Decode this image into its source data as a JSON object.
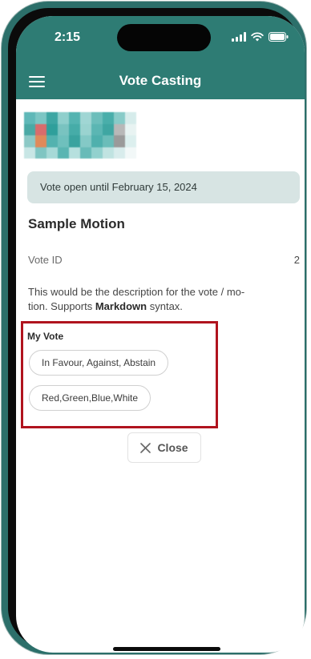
{
  "status_bar": {
    "time": "2:15"
  },
  "app_bar": {
    "title": "Vote Casting"
  },
  "colors": {
    "primary": "#2e7c74",
    "banner": "#d7e4e3",
    "highlight": "#b0131e"
  },
  "logo": {
    "pixels": [
      "#5fb8b8",
      "#7cc6c4",
      "#3da6a3",
      "#8fcfcc",
      "#54b4b1",
      "#a0d6d4",
      "#6cbebb",
      "#49aeaa",
      "#88cbc8",
      "#d6eceb",
      "#4aa9a5",
      "#d96c6c",
      "#2f9f9b",
      "#79c3c0",
      "#46aca8",
      "#9ad3d0",
      "#5bb6b3",
      "#3fa6a2",
      "#b8b8b8",
      "#e8f3f2",
      "#8cc9c6",
      "#e08a5a",
      "#53b2af",
      "#6fc0bd",
      "#3aa39f",
      "#84c9c6",
      "#4fb0ad",
      "#6bbdb9",
      "#9a9a9a",
      "#dcefee",
      "#c8e6e5",
      "#7fc5c2",
      "#a6d9d7",
      "#5ab5b2",
      "#b6e0de",
      "#68bbb8",
      "#92d1ce",
      "#c0e3e1",
      "#d8ecec",
      "#f2f8f8"
    ]
  },
  "banner": {
    "text": "Vote open until February 15, 2024"
  },
  "motion": {
    "title": "Sample Motion",
    "vote_id_label": "Vote ID",
    "vote_id_value": "2",
    "description_line1": "This would be the description for the vote / mo-",
    "description_line2_prefix": "tion. Supports ",
    "description_bold": "Markdown",
    "description_line2_suffix": " syntax."
  },
  "my_vote": {
    "label": "My Vote",
    "options": [
      "In Favour, Against, Abstain",
      "Red,Green,Blue,White"
    ]
  },
  "close_button": {
    "label": "Close",
    "icon": "close-icon"
  }
}
